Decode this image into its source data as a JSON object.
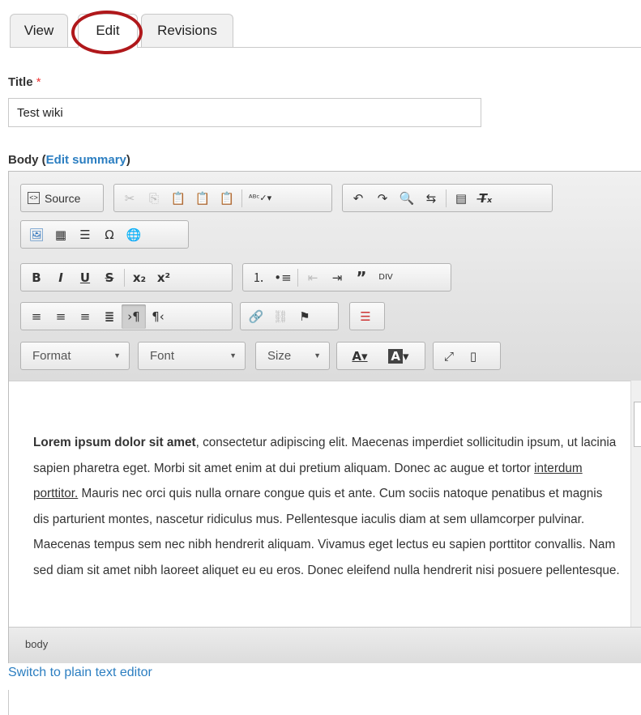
{
  "tabs": [
    {
      "label": "View"
    },
    {
      "label": "Edit"
    },
    {
      "label": "Revisions"
    }
  ],
  "title_field": {
    "label": "Title",
    "required_mark": "*",
    "value": "Test wiki"
  },
  "body_field": {
    "label": "Body",
    "open_paren": "(",
    "link": "Edit summary",
    "close_paren": ")"
  },
  "toolbar": {
    "source_label": "Source",
    "format_label": "Format",
    "font_label": "Font",
    "size_label": "Size"
  },
  "content": {
    "bold_text": "Lorem ipsum dolor sit amet",
    "text1": ", consectetur adipiscing elit. Maecenas imperdiet sollicitudin ipsum, ut lacinia sapien pharetra eget. Morbi sit amet enim at dui pretium aliquam. Donec ac augue et tortor ",
    "underlined": "interdum porttitor.",
    "text2": " Mauris nec orci quis nulla ornare congue quis et ante. Cum sociis natoque penatibus et magnis dis parturient montes, nascetur ridiculus mus. Pellentesque iaculis diam at sem ullamcorper pulvinar. Maecenas tempus sem nec nibh hendrerit aliquam. Vivamus eget lectus eu sapien porttitor convallis. Nam sed diam sit amet nibh laoreet aliquet eu eu eros. Donec eleifend nulla hendrerit nisi posuere pellentesque."
  },
  "statusbar": {
    "path": "body"
  },
  "switch_link": "Switch to plain text editor",
  "colors": {
    "link": "#2b7ec1",
    "highlight_circle": "#b0181b",
    "required": "#e33"
  }
}
